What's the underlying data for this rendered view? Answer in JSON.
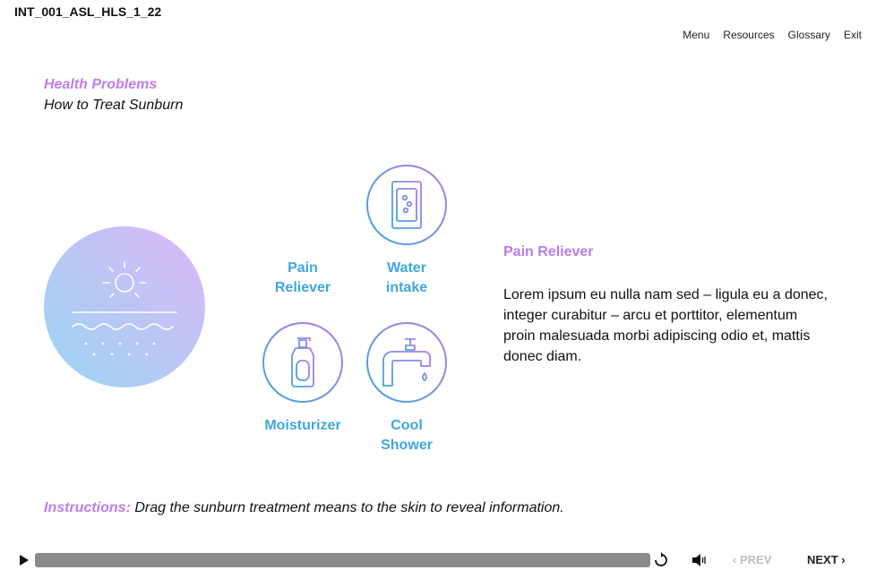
{
  "header": {
    "course_id": "INT_001_ASL_HLS_1_22",
    "nav": [
      "Menu",
      "Resources",
      "Glossary",
      "Exit"
    ]
  },
  "slide": {
    "title": "Health Problems",
    "subtitle": "How to Treat Sunburn"
  },
  "drag_items": [
    {
      "label": "Pain\nReliever",
      "icon": "pain-reliever-icon"
    },
    {
      "label": "Water\nintake",
      "icon": "water-glass-icon"
    },
    {
      "label": "Moisturizer",
      "icon": "lotion-bottle-icon"
    },
    {
      "label": "Cool\nShower",
      "icon": "faucet-icon"
    }
  ],
  "drop_target": {
    "icon": "sun-skin-icon"
  },
  "info": {
    "heading": "Pain Reliever",
    "body": "Lorem ipsum eu nulla nam sed – ligula eu a donec, integer curabitur – arcu et porttitor, elementum proin malesuada morbi adipiscing odio et, mattis donec diam."
  },
  "instructions": {
    "lead": "Instructions:",
    "text": "Drag the sunburn treatment means to the skin to reveal information."
  },
  "player": {
    "prev_label": "PREV",
    "next_label": "NEXT",
    "progress": 1.0,
    "colors": {
      "accent_purple": "#c07de8",
      "accent_blue": "#3fa7dc",
      "track": "#8a8a8a"
    }
  }
}
